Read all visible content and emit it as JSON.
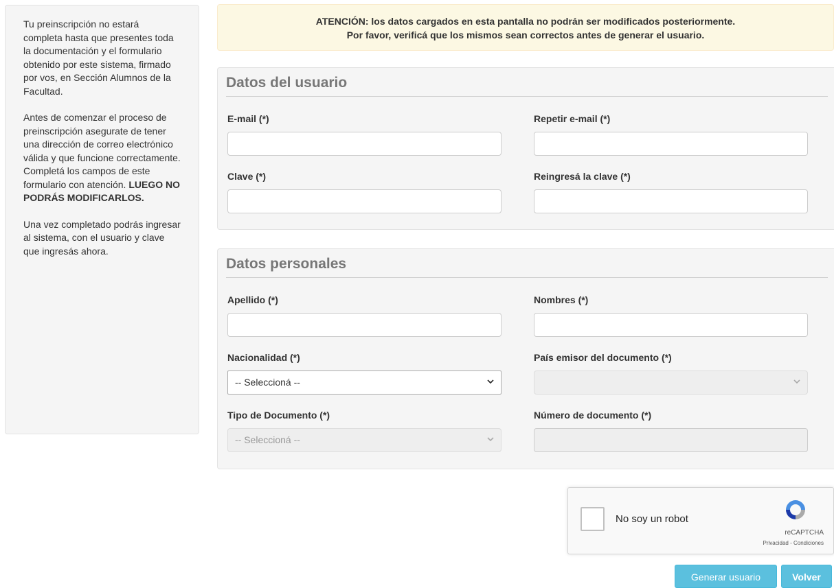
{
  "sidebar": {
    "p1": "Tu preinscripción no estará completa hasta que presentes toda la documentación y el formulario obtenido por este sistema, firmado por vos, en Sección Alumnos de la Facultad.",
    "p2": "Antes de comenzar el proceso de preinscripción asegurate de tener una dirección de correo electrónico válida y que funcione correctamente. Completá los campos de este formulario con atención.",
    "p2_bold": "LUEGO NO PODRÁS MODIFICARLOS.",
    "p3": "Una vez completado podrás ingresar al sistema, con el usuario y clave que ingresás ahora."
  },
  "alert": {
    "line1_prefix": "ATENCIÓN:",
    "line1": " los datos cargados en esta pantalla no podrán ser modificados posteriormente.",
    "line2": "Por favor, verificá que los mismos sean correctos antes de generar el usuario."
  },
  "user_section": {
    "title": "Datos del usuario",
    "email_label": "E-mail (*)",
    "email_repeat_label": "Repetir e-mail (*)",
    "password_label": "Clave (*)",
    "password_repeat_label": "Reingresá la clave (*)"
  },
  "personal_section": {
    "title": "Datos personales",
    "lastname_label": "Apellido (*)",
    "names_label": "Nombres (*)",
    "nationality_label": "Nacionalidad (*)",
    "nationality_value": "-- Seleccioná --",
    "issuing_country_label": "País emisor del documento (*)",
    "issuing_country_value": "",
    "doc_type_label": "Tipo de Documento (*)",
    "doc_type_value": "-- Seleccioná --",
    "doc_number_label": "Número de documento (*)"
  },
  "captcha": {
    "label": "No soy un robot",
    "brand": "reCAPTCHA",
    "links": "Privacidad - Condiciones"
  },
  "buttons": {
    "generate": "Generar usuario",
    "back": "Volver"
  },
  "colors": {
    "alert_bg": "#fcf8e3",
    "well_bg": "#f5f5f5",
    "button_info": "#5bc0de"
  }
}
